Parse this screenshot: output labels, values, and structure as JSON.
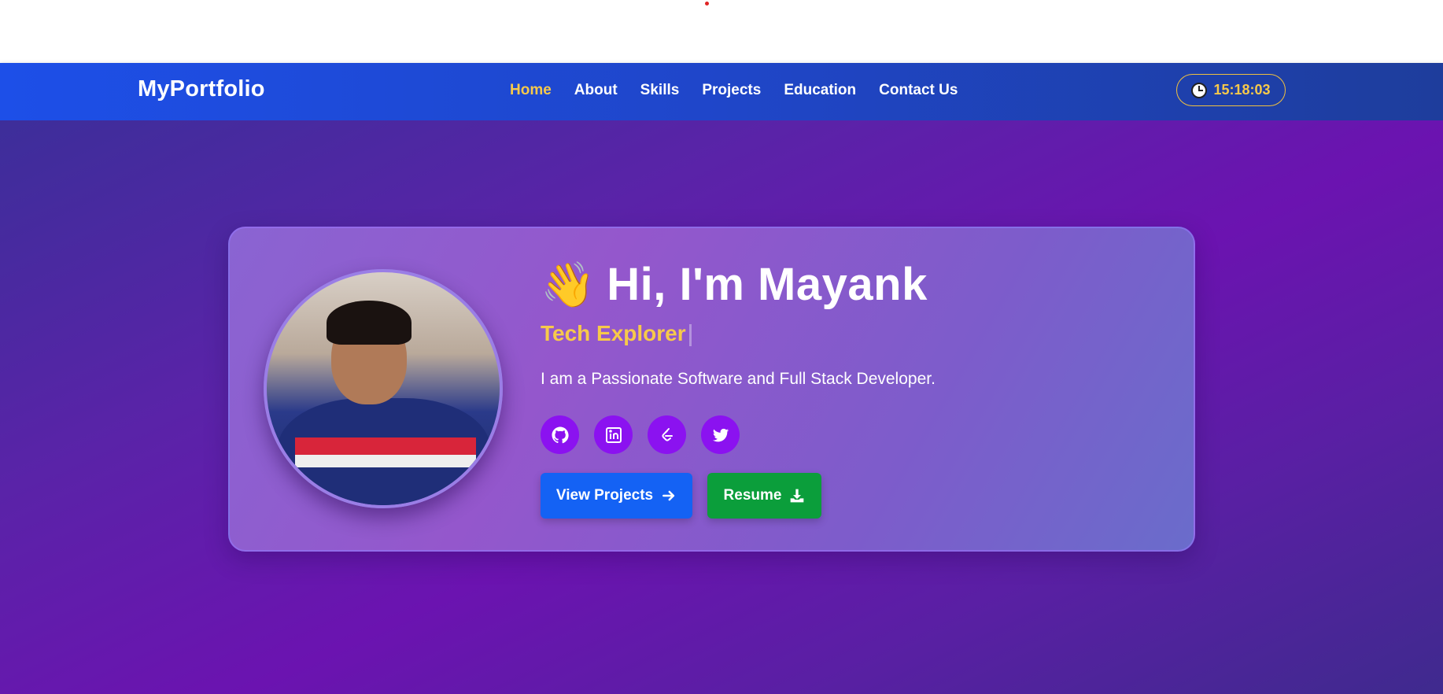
{
  "navbar": {
    "brand": "MyPortfolio",
    "links": [
      {
        "label": "Home",
        "active": true
      },
      {
        "label": "About",
        "active": false
      },
      {
        "label": "Skills",
        "active": false
      },
      {
        "label": "Projects",
        "active": false
      },
      {
        "label": "Education",
        "active": false
      },
      {
        "label": "Contact Us",
        "active": false
      }
    ],
    "clock": {
      "icon": "clock-icon",
      "time": "15:18:03"
    }
  },
  "hero": {
    "wave_emoji": "👋",
    "greeting": "Hi, I'm Mayank",
    "typed_role": "Tech Explorer",
    "description": "I am a Passionate Software and Full Stack Developer.",
    "socials": [
      {
        "name": "github-icon"
      },
      {
        "name": "linkedin-icon"
      },
      {
        "name": "leetcode-icon"
      },
      {
        "name": "twitter-icon"
      }
    ],
    "buttons": {
      "projects_label": "View Projects",
      "resume_label": "Resume"
    }
  },
  "colors": {
    "accent_yellow": "#f7c94a",
    "social_purple": "#8b12f0",
    "primary_blue": "#1462f4",
    "resume_green": "#0b9e3b"
  }
}
